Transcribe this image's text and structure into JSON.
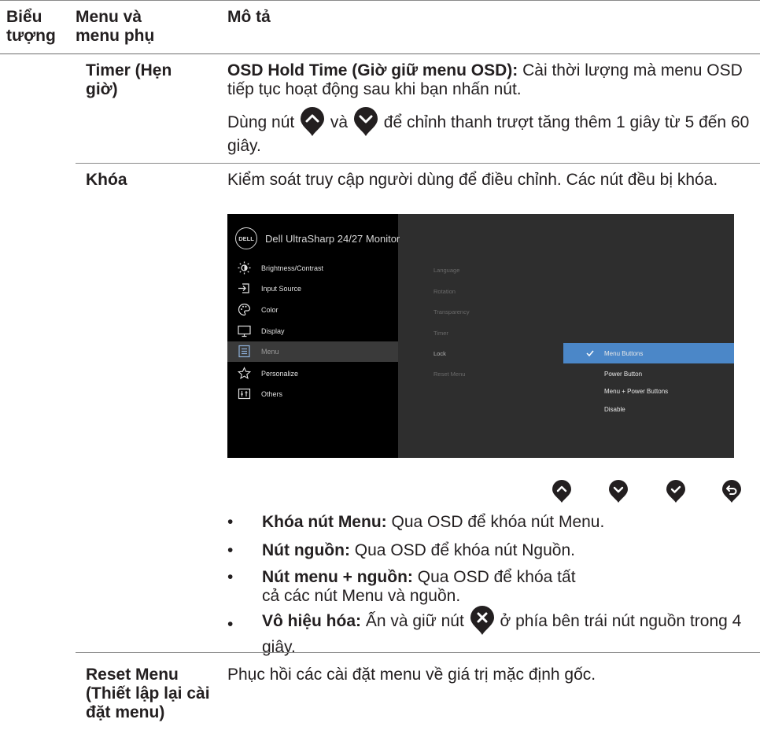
{
  "table_header": {
    "col1": "Biểu tượng",
    "col2": "Menu và menu phụ",
    "col3": "Mô tả"
  },
  "rows": {
    "timer": {
      "name": "Timer (Hẹn giờ)",
      "osd_hold_label": "OSD Hold Time (Giờ giữ menu OSD):",
      "osd_hold_desc": "Cài thời lượng mà menu OSD tiếp tục hoạt động sau khi bạn nhấn nút.",
      "use_prefix": "Dùng nút",
      "use_and": "và",
      "use_suffix": "để chỉnh thanh trượt tăng thêm 1 giây từ 5 đến 60 giây."
    },
    "lock": {
      "name": "Khóa",
      "desc": "Kiểm soát truy cập người dùng để điều chỉnh. Các nút đều bị khóa.",
      "bullets": [
        {
          "label": "Khóa nút Menu:",
          "text": "Qua OSD để khóa nút Menu."
        },
        {
          "label": "Nút nguồn:",
          "text": "Qua OSD để khóa nút Nguồn."
        },
        {
          "label": "Nút menu + nguồn:",
          "text": "Qua OSD để khóa tất cả các nút Menu và nguồn."
        },
        {
          "label": "Vô hiệu hóa:",
          "text_before": "Ấn và giữ nút",
          "text_after": "ở phía bên trái nút nguồn trong 4 giây."
        }
      ]
    },
    "reset": {
      "name": "Reset Menu (Thiết lập lại cài đặt menu)",
      "desc": "Phục hồi các cài đặt menu về giá trị mặc định gốc."
    }
  },
  "osd": {
    "logo": "DELL",
    "title": "Dell UltraSharp 24/27 Monitor",
    "menu": [
      {
        "label": "Brightness/Contrast",
        "icon": "brightness-icon"
      },
      {
        "label": "Input Source",
        "icon": "input-source-icon"
      },
      {
        "label": "Color",
        "icon": "color-palette-icon"
      },
      {
        "label": "Display",
        "icon": "display-icon"
      },
      {
        "label": "Menu",
        "icon": "menu-icon"
      },
      {
        "label": "Personalize",
        "icon": "star-icon"
      },
      {
        "label": "Others",
        "icon": "others-icon"
      }
    ],
    "submenu": [
      "Language",
      "Rotation",
      "Transparency",
      "Timer",
      "Lock",
      "Reset Menu"
    ],
    "options": [
      "Menu Buttons",
      "Power Button",
      "Menu + Power Buttons",
      "Disable"
    ],
    "selected_option": "Menu Buttons",
    "accent": "#4b87c8"
  },
  "nav_buttons": [
    "up-button-icon",
    "down-button-icon",
    "check-button-icon",
    "back-button-icon"
  ],
  "bullet_char": "•"
}
